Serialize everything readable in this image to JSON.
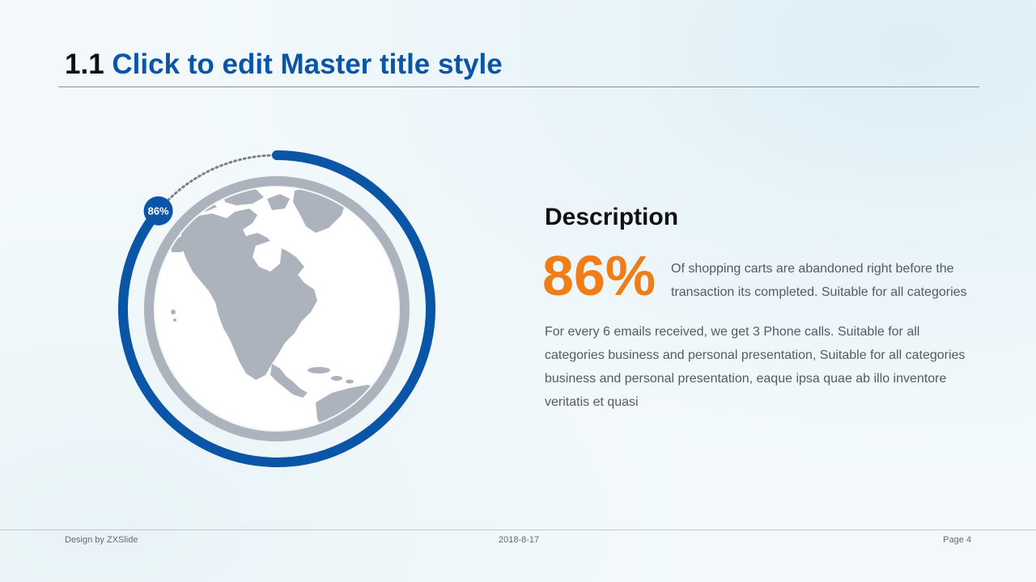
{
  "slide": {
    "title_number": "1.1",
    "title_text": "Click to edit Master title style"
  },
  "colors": {
    "accent_blue": "#0b55a6",
    "accent_orange": "#f07d16",
    "globe_gray": "#adb3bc",
    "body_text": "#555b61"
  },
  "progress": {
    "percent": 86,
    "badge_label": "86%"
  },
  "description": {
    "heading": "Description",
    "big_value": "86%",
    "value_caption": "Of shopping carts are abandoned right before the transaction its completed. Suitable for all categories",
    "body": "For every 6 emails received, we get 3 Phone calls. Suitable for all categories business and personal presentation, Suitable for all categories business and personal presentation, eaque ipsa quae ab illo inventore veritatis et quasi"
  },
  "icons": {
    "globe": "globe-icon"
  },
  "footer": {
    "left": "Design by ZXSlide",
    "center": "2018-8-17",
    "right": "Page 4"
  }
}
